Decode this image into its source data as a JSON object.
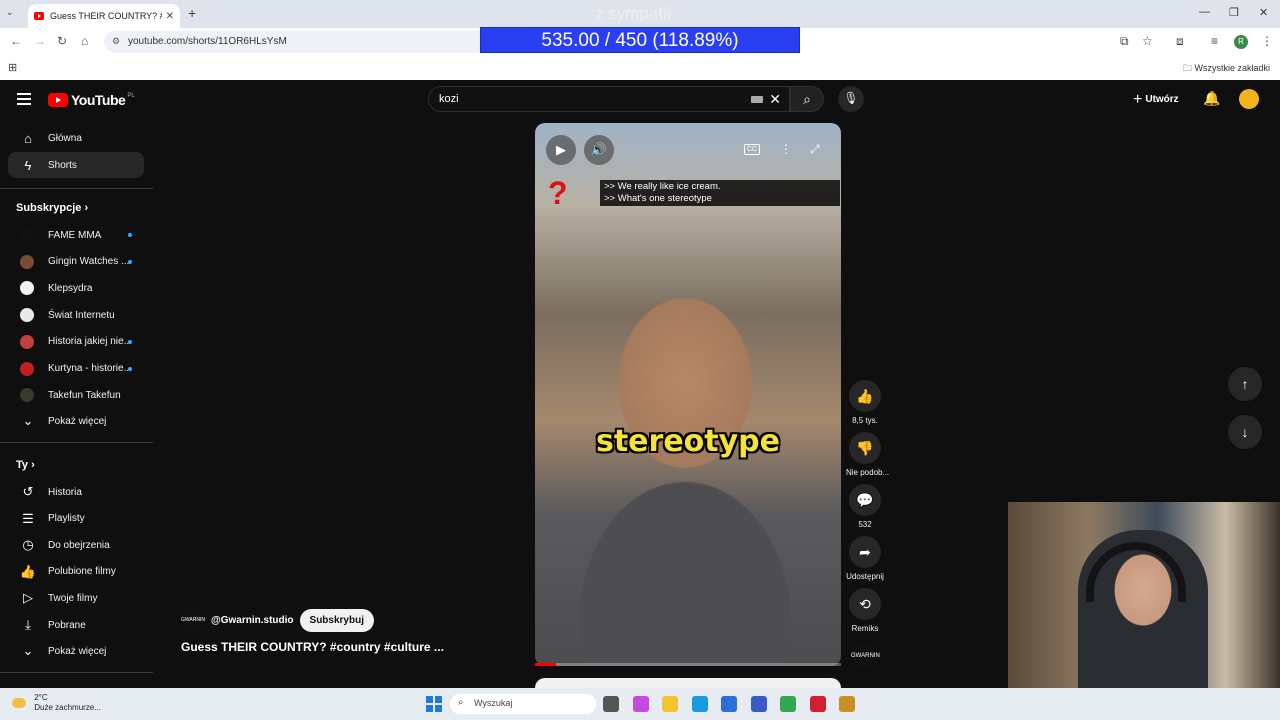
{
  "browser": {
    "tab_title": "Guess THEIR COUNTRY? #country #culture",
    "url": "youtube.com/shorts/11OR6HLsYsM",
    "bookmarks_label": "Wszystkie zakładki",
    "profile_initial": "R"
  },
  "overlay": {
    "top_text": "z sympatii",
    "score": "535.00 / 450 (118.89%)"
  },
  "youtube": {
    "logo_text": "YouTube",
    "region": "PL",
    "search_value": "kozi",
    "create_label": "Utwórz"
  },
  "sidebar": {
    "main": [
      {
        "label": "Główna",
        "icon": "home-icon"
      },
      {
        "label": "Shorts",
        "icon": "shorts-icon"
      }
    ],
    "subs_heading": "Subskrypcje",
    "subscriptions": [
      {
        "label": "FAME MMA",
        "color": "#111111",
        "dot": true
      },
      {
        "label": "Gingin Watches ...",
        "color": "#7a4a32",
        "dot": true
      },
      {
        "label": "Klepsydra",
        "color": "#f1f1f1",
        "dot": false
      },
      {
        "label": "Świat Internetu",
        "color": "#e8e8e8",
        "dot": false
      },
      {
        "label": "Historia jakiej nie...",
        "color": "#c04040",
        "dot": true
      },
      {
        "label": "Kurtyna - historie...",
        "color": "#c02020",
        "dot": true
      },
      {
        "label": "Takefun Takefun",
        "color": "#3a3a2a",
        "dot": false
      }
    ],
    "subs_more": "Pokaż więcej",
    "you_heading": "Ty",
    "you_items": [
      {
        "label": "Historia",
        "icon": "history-icon"
      },
      {
        "label": "Playlisty",
        "icon": "playlist-icon"
      },
      {
        "label": "Do obejrzenia",
        "icon": "clock-icon"
      },
      {
        "label": "Polubione filmy",
        "icon": "thumb-up-icon"
      },
      {
        "label": "Twoje filmy",
        "icon": "video-icon"
      },
      {
        "label": "Pobrane",
        "icon": "download-icon"
      }
    ],
    "you_more": "Pokaż więcej"
  },
  "video": {
    "caption_line1": ">> We really like ice cream.",
    "caption_line2": ">> What's one stereotype",
    "overlay_word": "stereotype",
    "cc_label": "CC",
    "progress": 0.07,
    "channel_handle": "@Gwarnin.studio",
    "channel_avatar_text": "GWARNIN",
    "subscribe_label": "Subskrybuj",
    "title": "Guess THEIR COUNTRY? #country #culture ..."
  },
  "actions": {
    "likes": "8,5 tys.",
    "dislike_label": "Nie podob...",
    "comments": "532",
    "share_label": "Udostępnij",
    "remix_label": "Remiks"
  },
  "taskbar": {
    "temp": "2°C",
    "weather": "Duże zachmurze...",
    "search_placeholder": "Wyszukaj",
    "apps": [
      "#555555",
      "#c54be0",
      "#f4c430",
      "#1a9be0",
      "#2b6ed8",
      "#3a5ac8",
      "#33a852",
      "#d02030",
      "#c89020"
    ]
  }
}
